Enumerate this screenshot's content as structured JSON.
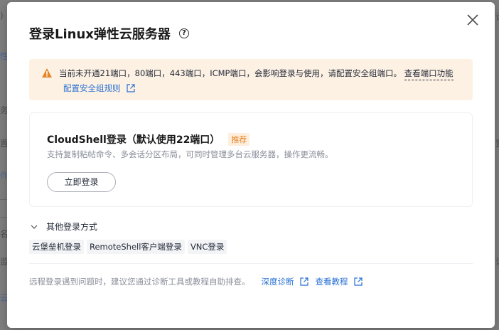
{
  "dialog": {
    "title": "登录Linux弹性云服务器"
  },
  "alert": {
    "message": "当前未开通21端口，80端口，443端口，ICMP端口，会影响登录与使用，请配置安全组端口。",
    "view_ports_link": "查看端口功能",
    "config_rules_link": "配置安全组规则"
  },
  "cloudshell": {
    "title": "CloudShell登录（默认使用22端口）",
    "badge": "推荐",
    "description": "支持复制粘帖命令、多会话分区布局，可同时管理多台云服务器，操作更流畅。",
    "login_button": "立即登录"
  },
  "other_methods": {
    "label": "其他登录方式",
    "items": [
      "云堡垒机登录",
      "RemoteShell客户端登录",
      "VNC登录"
    ]
  },
  "footer": {
    "hint": "远程登录遇到问题时，建议您通过诊断工具或教程自助排查。",
    "diagnose_link": "深度诊断",
    "tutorial_link": "查看教程"
  },
  "colors": {
    "accent": "#2770d4",
    "warning_bg": "#fdf1e3",
    "warning_icon": "#e5862a"
  }
}
